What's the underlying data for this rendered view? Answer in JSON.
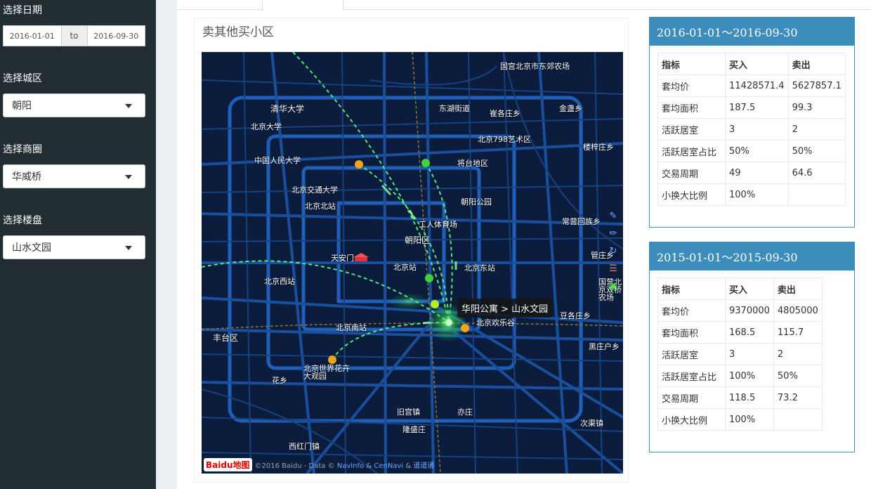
{
  "sidebar": {
    "date_label": "选择日期",
    "date_from": "2016-01-01",
    "date_sep": "to",
    "date_to": "2016-09-30",
    "district_label": "选择城区",
    "district_value": "朝阳",
    "area_label": "选择商圈",
    "area_value": "华威桥",
    "building_label": "选择楼盘",
    "building_value": "山水文园"
  },
  "map": {
    "title": "卖其他买小区",
    "tooltip": "华阳公寓 > 山水文园",
    "logo": "Baidu地图",
    "copyright": "©2016 Baidu - Data © ",
    "copyright_links": [
      "NavInfo",
      "CenNavi",
      "道道通"
    ],
    "labels": [
      "国宫北京市东郊农场",
      "清华大学",
      "东湖街道",
      "崔各庄乡",
      "金盏乡",
      "北京大学",
      "北京798艺术区",
      "楼梓庄乡",
      "中国人民大学",
      "将台地区",
      "北京交通大学",
      "朝阳公园",
      "北京北站",
      "工人体育场",
      "常营回族乡",
      "朝阳区",
      "天安门",
      "管庄乡",
      "北京站",
      "北京东站",
      "北京西站",
      "国营北京双桥农场",
      "华阳公寓 > 山水文园",
      "北京南站",
      "北京欢乐谷",
      "豆各庄乡",
      "丰台区",
      "黑庄户乡",
      "北京世界花卉大观园",
      "花乡",
      "旧宫镇",
      "亦庄",
      "隆盛庄",
      "次渠镇",
      "西红门镇"
    ],
    "colors": {
      "bg": "#0b1c3d",
      "road": "#1f5fb8",
      "flow": "#5cff7a",
      "dot_orange": "#f2a516",
      "dot_green": "#3fd23f"
    }
  },
  "stats": [
    {
      "period": "2016-01-01～2016-09-30",
      "headers": [
        "指标",
        "买入",
        "卖出"
      ],
      "rows": [
        [
          "套均价",
          "11428571.4",
          "5627857.1"
        ],
        [
          "套均面积",
          "187.5",
          "99.3"
        ],
        [
          "活跃居室",
          "3",
          "2"
        ],
        [
          "活跃居室占比",
          "50%",
          "50%"
        ],
        [
          "交易周期",
          "49",
          "64.6"
        ],
        [
          "小换大比例",
          "100%",
          ""
        ]
      ]
    },
    {
      "period": "2015-01-01～2015-09-30",
      "headers": [
        "指标",
        "买入",
        "卖出"
      ],
      "rows": [
        [
          "套均价",
          "9370000",
          "4805000"
        ],
        [
          "套均面积",
          "168.5",
          "115.7"
        ],
        [
          "活跃居室",
          "3",
          "2"
        ],
        [
          "活跃居室占比",
          "100%",
          "50%"
        ],
        [
          "交易周期",
          "118.5",
          "73.2"
        ],
        [
          "小换大比例",
          "100%",
          ""
        ]
      ]
    }
  ]
}
